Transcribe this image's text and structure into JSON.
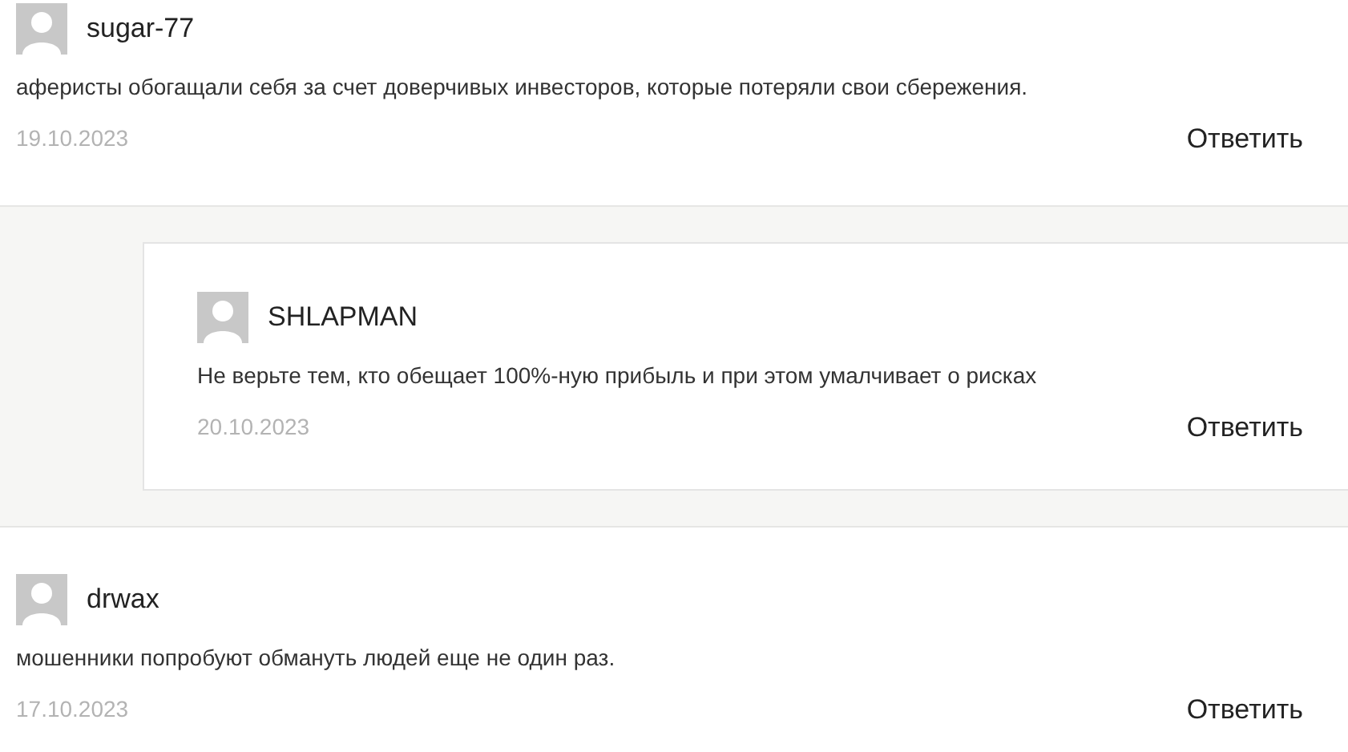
{
  "comments": [
    {
      "author": "sugar-77",
      "text": "аферисты обогащали себя за счет доверчивых инвесторов, которые потеряли свои сбережения.",
      "date": "19.10.2023",
      "reply_label": "Ответить",
      "children": [
        {
          "author": "SHLAPMAN",
          "text": "Не верьте тем, кто обещает 100%-ную прибыль и при этом умалчивает о рисках",
          "date": "20.10.2023",
          "reply_label": "Ответить"
        }
      ]
    },
    {
      "author": "drwax",
      "text": "мошенники попробуют обмануть людей еще не один раз.",
      "date": "17.10.2023",
      "reply_label": "Ответить"
    }
  ]
}
